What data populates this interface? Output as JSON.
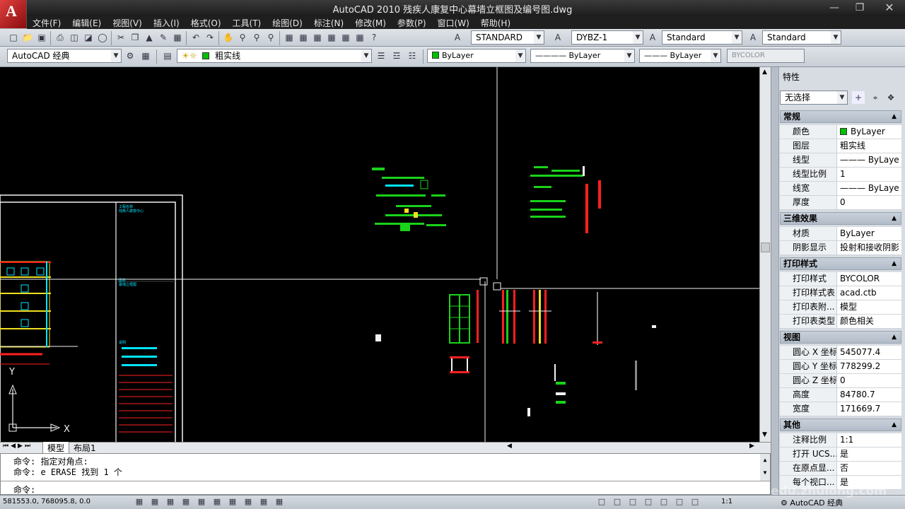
{
  "window": {
    "title": "AutoCAD 2010      残疾人康复中心幕墙立框图及编号图.dwg"
  },
  "menu": [
    "文件(F)",
    "编辑(E)",
    "视图(V)",
    "插入(I)",
    "格式(O)",
    "工具(T)",
    "绘图(D)",
    "标注(N)",
    "修改(M)",
    "参数(P)",
    "窗口(W)",
    "帮助(H)"
  ],
  "toolbar1": {
    "textstyle": "STANDARD",
    "dimstyle": "DYBZ-1",
    "tablestyle": "Standard",
    "mleaderstyle": "Standard"
  },
  "toolbar2": {
    "workspace": "AutoCAD 经典",
    "layer": "粗实线",
    "color": "ByLayer",
    "linetype": "ByLayer",
    "lineweight": "ByLayer",
    "plotstyle": "BYCOLOR"
  },
  "tabs": {
    "model": "模型",
    "layout": "布局1"
  },
  "command": {
    "line1": "命令: 指定对角点:",
    "line2": "命令: e ERASE 找到 1 个",
    "prompt": "命令:"
  },
  "status": {
    "coords": "581553.0, 768095.8, 0.0",
    "annoscale": "1:1",
    "workspace": "AutoCAD 经典",
    "watermark": "edu.zhulong.com"
  },
  "properties": {
    "title": "特性",
    "selection": "无选择",
    "sections": [
      {
        "name": "常规",
        "rows": [
          {
            "k": "颜色",
            "v": "ByLayer",
            "swatch": "#00c000"
          },
          {
            "k": "图层",
            "v": "粗实线"
          },
          {
            "k": "线型",
            "v": "ByLayer",
            "line": true
          },
          {
            "k": "线型比例",
            "v": "1"
          },
          {
            "k": "线宽",
            "v": "ByLayer",
            "line": true
          },
          {
            "k": "厚度",
            "v": "0"
          }
        ]
      },
      {
        "name": "三维效果",
        "rows": [
          {
            "k": "材质",
            "v": "ByLayer"
          },
          {
            "k": "阴影显示",
            "v": "投射和接收阴影"
          }
        ]
      },
      {
        "name": "打印样式",
        "rows": [
          {
            "k": "打印样式",
            "v": "BYCOLOR"
          },
          {
            "k": "打印样式表",
            "v": "acad.ctb"
          },
          {
            "k": "打印表附...",
            "v": "模型"
          },
          {
            "k": "打印表类型",
            "v": "颜色相关"
          }
        ]
      },
      {
        "name": "视图",
        "rows": [
          {
            "k": "圆心 X 坐标",
            "v": "545077.4"
          },
          {
            "k": "圆心 Y 坐标",
            "v": "778299.2"
          },
          {
            "k": "圆心 Z 坐标",
            "v": "0"
          },
          {
            "k": "高度",
            "v": "84780.7"
          },
          {
            "k": "宽度",
            "v": "171669.7"
          }
        ]
      },
      {
        "name": "其他",
        "rows": [
          {
            "k": "注释比例",
            "v": "1:1"
          },
          {
            "k": "打开 UCS...",
            "v": "是"
          },
          {
            "k": "在原点显...",
            "v": "否"
          },
          {
            "k": "每个视口...",
            "v": "是"
          }
        ]
      }
    ]
  },
  "colors": {
    "canvas": "#000000",
    "crosshair": "#ffffff",
    "cyan": "#00e5ff",
    "green": "#19d219",
    "red": "#ff2020",
    "yellow": "#f0e020"
  }
}
